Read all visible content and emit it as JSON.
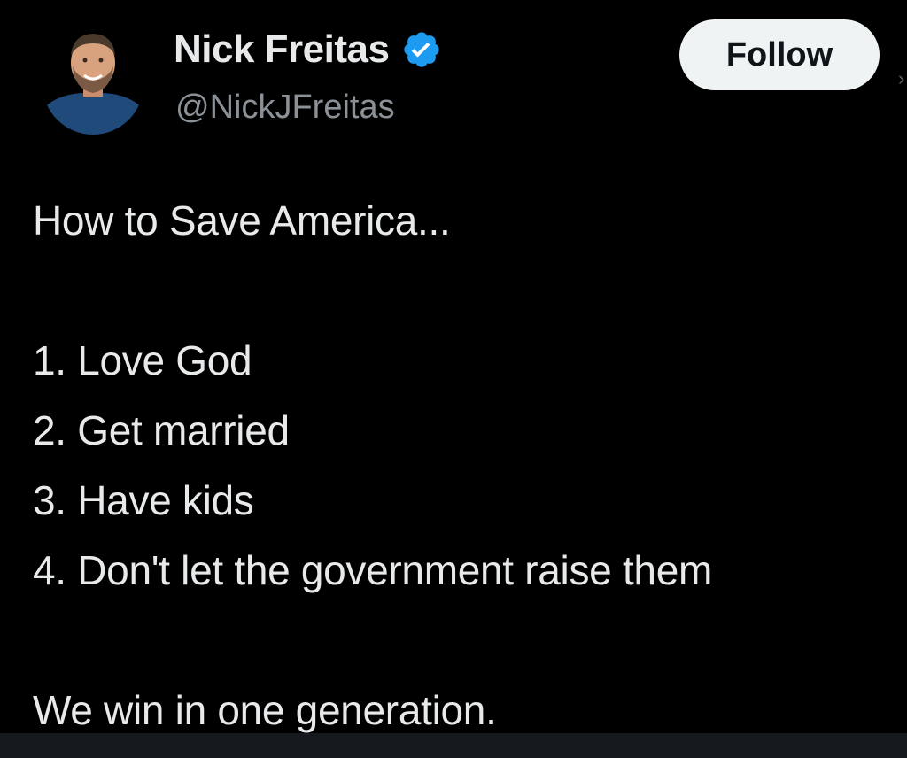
{
  "author": {
    "display_name": "Nick Freitas",
    "handle": "@NickJFreitas",
    "verified": true,
    "verified_color": "#1d9bf0",
    "avatar_icon": "profile-photo"
  },
  "follow_button": {
    "label": "Follow"
  },
  "tweet": {
    "lines": [
      "How to Save America...",
      "",
      "1. Love God",
      "2. Get married",
      "3. Have kids",
      "4. Don't let the government raise them",
      "",
      "We win in one generation."
    ]
  },
  "colors": {
    "background": "#000000",
    "text": "#e7e9ea",
    "secondary_text": "#8b9196",
    "button_bg": "#eff3f4",
    "button_text": "#0f1419"
  }
}
